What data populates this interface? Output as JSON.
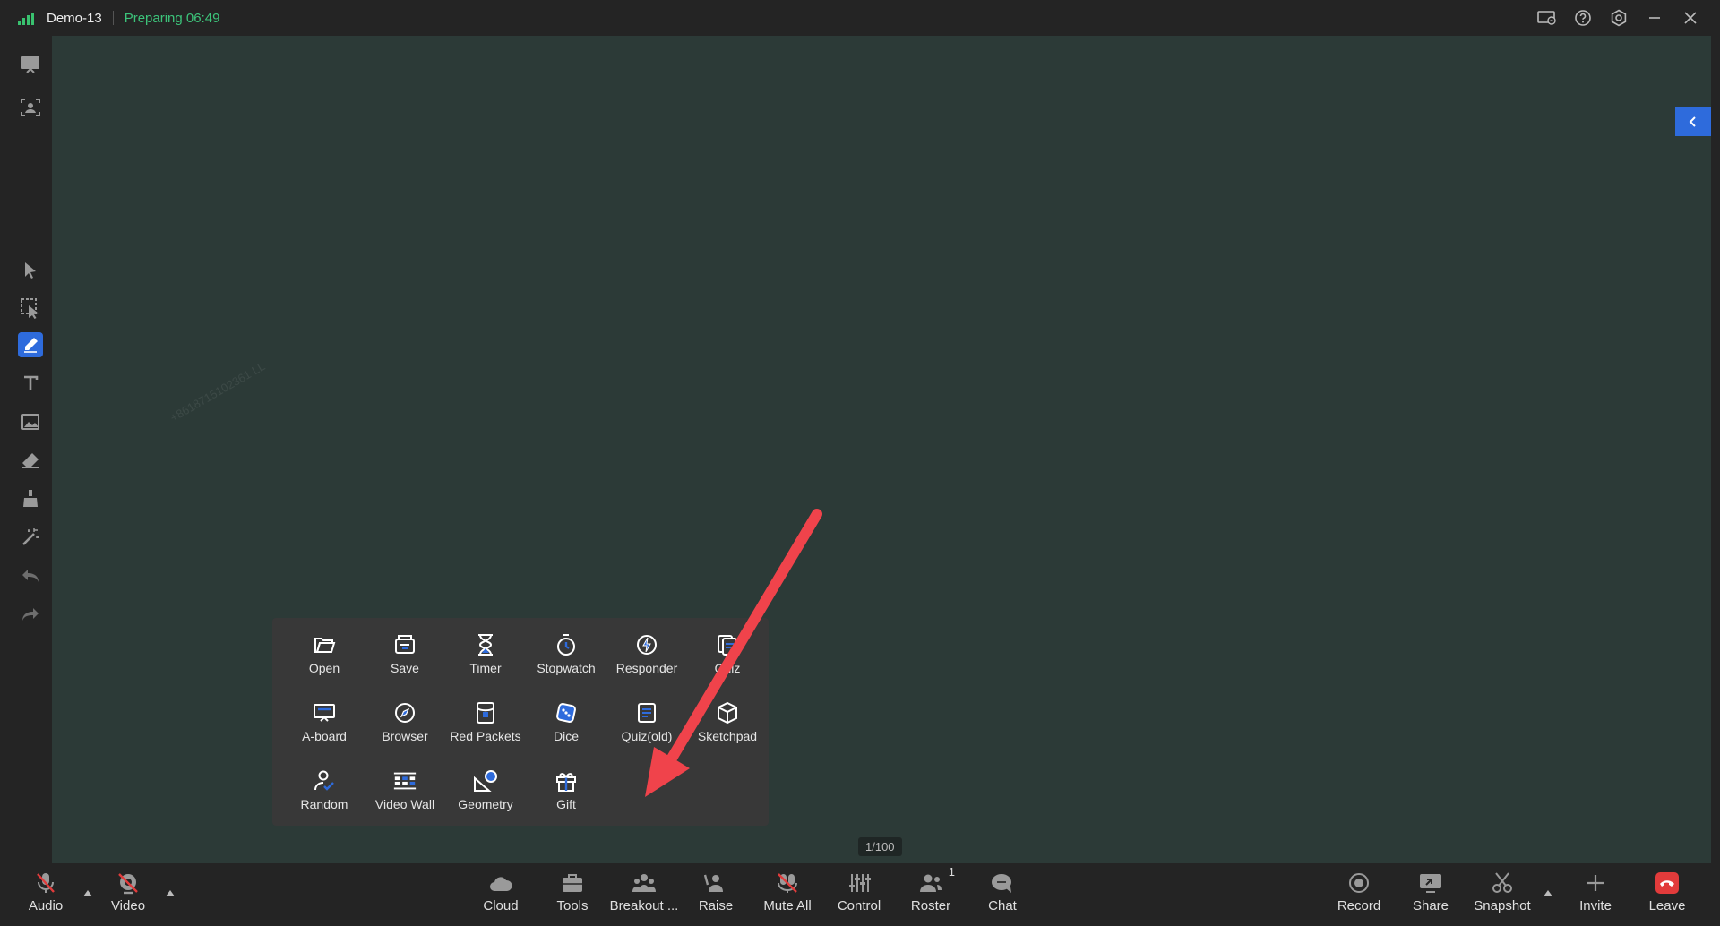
{
  "titlebar": {
    "room_name": "Demo-13",
    "status": "Preparing 06:49",
    "status_color": "#3cc37a"
  },
  "colors": {
    "accent": "#2e6bdc",
    "canvas": "#2c3a37",
    "leave": "#e23b3b",
    "annotation_arrow": "#f0434b"
  },
  "canvas": {
    "watermark": "+8618715102361 LL",
    "page_counter": "1/100"
  },
  "tools_panel": {
    "items": [
      {
        "label": "Open",
        "icon": "folder-open-icon"
      },
      {
        "label": "Save",
        "icon": "save-icon"
      },
      {
        "label": "Timer",
        "icon": "hourglass-icon"
      },
      {
        "label": "Stopwatch",
        "icon": "stopwatch-icon"
      },
      {
        "label": "Responder",
        "icon": "responder-icon"
      },
      {
        "label": "Quiz",
        "icon": "quiz-icon"
      },
      {
        "label": "A-board",
        "icon": "a-board-icon"
      },
      {
        "label": "Browser",
        "icon": "compass-icon"
      },
      {
        "label": "Red Packets",
        "icon": "red-packet-icon"
      },
      {
        "label": "Dice",
        "icon": "dice-icon"
      },
      {
        "label": "Quiz(old)",
        "icon": "quiz-old-icon"
      },
      {
        "label": "Sketchpad",
        "icon": "cube-icon"
      },
      {
        "label": "Random",
        "icon": "random-user-icon"
      },
      {
        "label": "Video Wall",
        "icon": "video-wall-icon"
      },
      {
        "label": "Geometry",
        "icon": "geometry-icon"
      },
      {
        "label": "Gift",
        "icon": "gift-icon"
      }
    ]
  },
  "bottombar": {
    "audio": "Audio",
    "video": "Video",
    "cloud": "Cloud",
    "tools": "Tools",
    "breakout": "Breakout ...",
    "raise": "Raise",
    "mute_all": "Mute All",
    "control": "Control",
    "roster": "Roster",
    "roster_count": "1",
    "chat": "Chat",
    "record": "Record",
    "share": "Share",
    "snapshot": "Snapshot",
    "invite": "Invite",
    "leave": "Leave"
  }
}
